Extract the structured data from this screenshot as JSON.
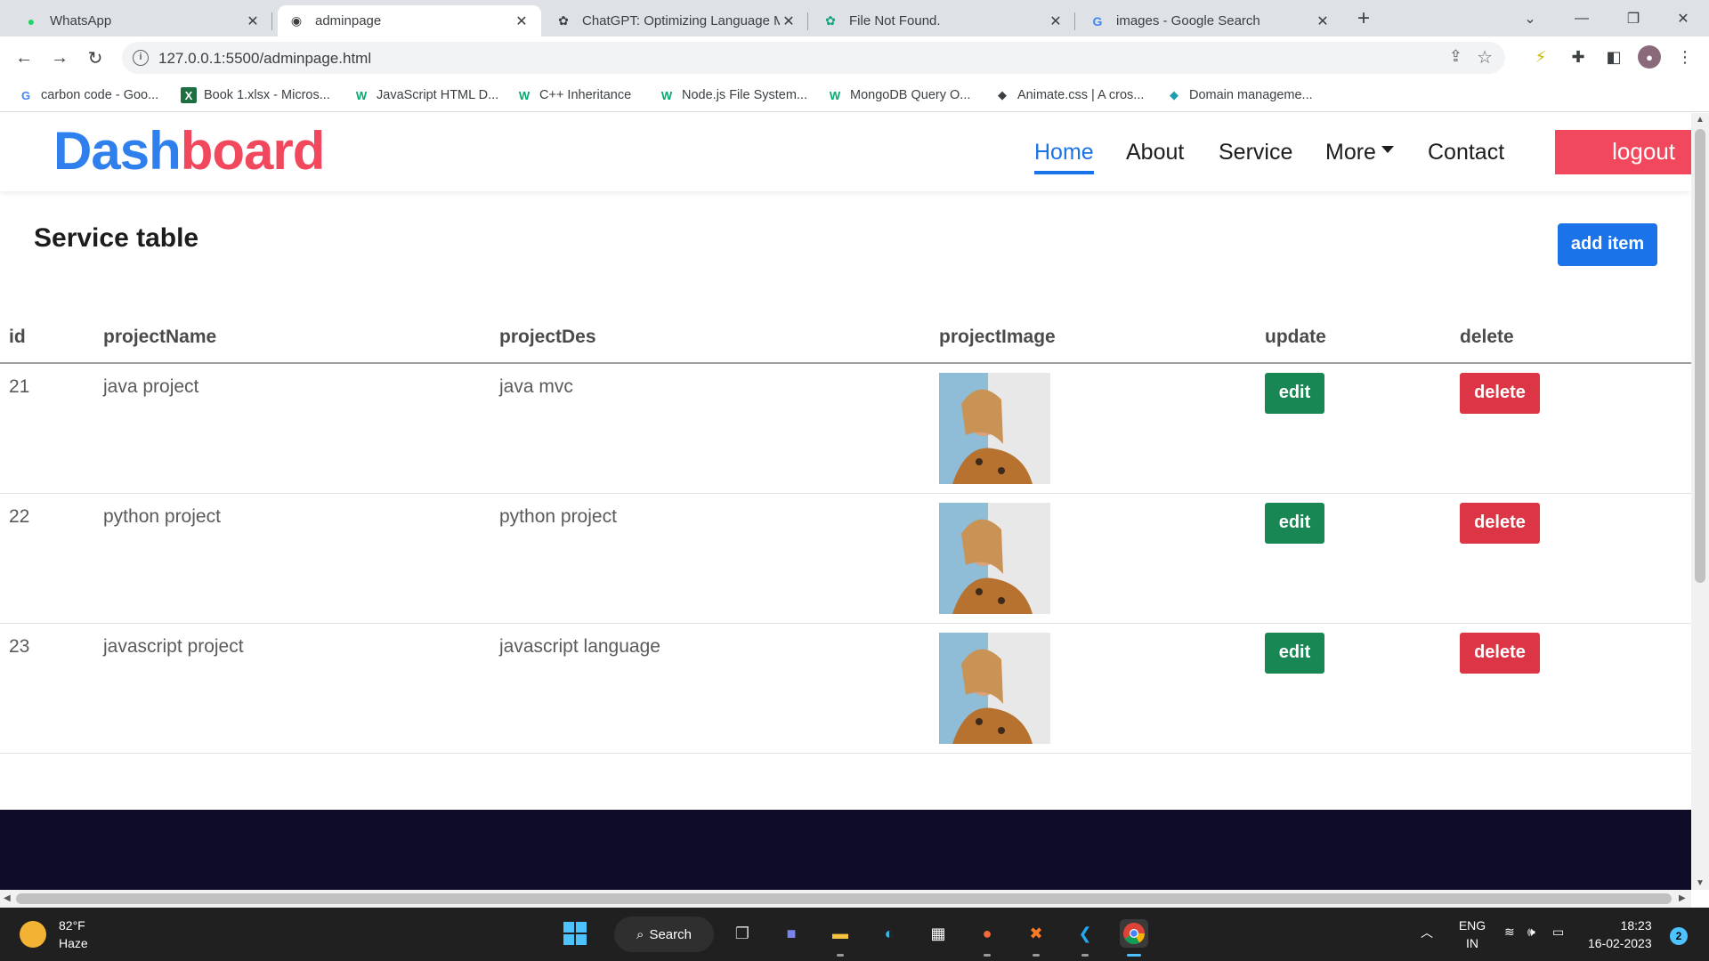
{
  "browser": {
    "tabs": [
      {
        "title": "WhatsApp",
        "icon": "whatsapp-icon"
      },
      {
        "title": "adminpage",
        "icon": "globe-icon"
      },
      {
        "title": "ChatGPT: Optimizing Language M",
        "icon": "chatgpt-icon"
      },
      {
        "title": "File Not Found.",
        "icon": "chatgpt-icon"
      },
      {
        "title": "images - Google Search",
        "icon": "google-icon"
      }
    ],
    "url": "127.0.0.1:5500/adminpage.html",
    "bookmarks": [
      {
        "label": "carbon code - Goo...",
        "icon": "google-icon"
      },
      {
        "label": "Book 1.xlsx - Micros...",
        "icon": "excel-icon"
      },
      {
        "label": "JavaScript HTML D...",
        "icon": "w3schools-icon"
      },
      {
        "label": "C++ Inheritance",
        "icon": "w3schools-icon"
      },
      {
        "label": "Node.js File System...",
        "icon": "w3schools-icon"
      },
      {
        "label": "MongoDB Query O...",
        "icon": "w3schools-icon"
      },
      {
        "label": "Animate.css | A cros...",
        "icon": "animate-icon"
      },
      {
        "label": "Domain manageme...",
        "icon": "domain-icon"
      }
    ]
  },
  "navbar": {
    "brand_part1": "Dash",
    "brand_part2": "board",
    "links": [
      "Home",
      "About",
      "Service",
      "More",
      "Contact"
    ],
    "logout": "logout"
  },
  "main": {
    "title": "Service table",
    "add_item": "add item",
    "columns": [
      "id",
      "projectName",
      "projectDes",
      "projectImage",
      "update",
      "delete"
    ],
    "rows": [
      {
        "id": "21",
        "name": "java project",
        "des": "java mvc",
        "edit": "edit",
        "delete": "delete"
      },
      {
        "id": "22",
        "name": "python project",
        "des": "python project",
        "edit": "edit",
        "delete": "delete"
      },
      {
        "id": "23",
        "name": "javascript project",
        "des": "javascript language",
        "edit": "edit",
        "delete": "delete"
      }
    ]
  },
  "taskbar": {
    "temperature": "82°F",
    "weather": "Haze",
    "search": "Search",
    "lang1": "ENG",
    "lang2": "IN",
    "time": "18:23",
    "date": "16-02-2023",
    "notifications": "2"
  },
  "colors": {
    "brand_blue": "#2f80ed",
    "brand_red": "#f2485d",
    "edit_green": "#198754",
    "delete_red": "#dc3545",
    "footer": "#0f0c29"
  }
}
